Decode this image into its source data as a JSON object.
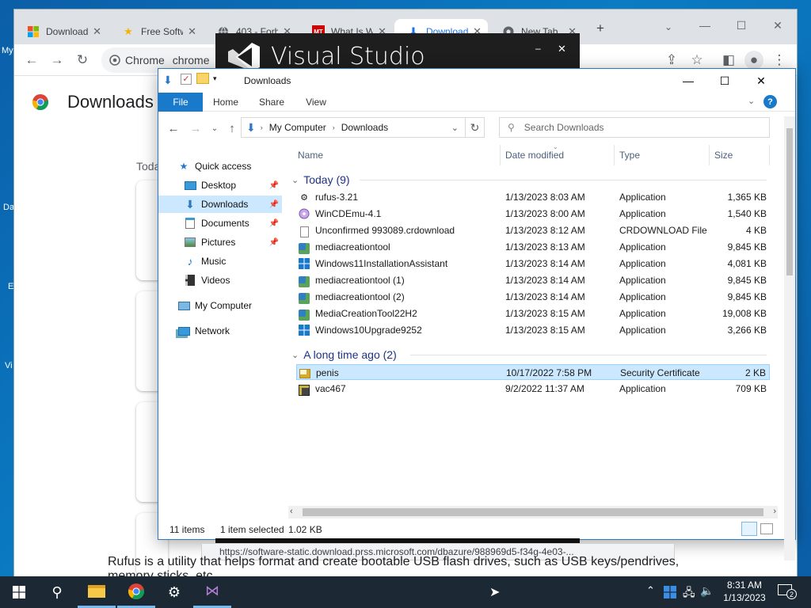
{
  "desktop": {
    "icon_labels": [
      "My",
      "Da",
      "E",
      "Vi"
    ]
  },
  "chrome": {
    "tabs": [
      {
        "label": "Download",
        "icon": "windows-logo-icon",
        "active": false
      },
      {
        "label": "Free Softw",
        "icon": "star-icon",
        "active": false
      },
      {
        "label": "403 - Forb",
        "icon": "globe-icon",
        "active": false
      },
      {
        "label": "What Is W",
        "icon": "mt-logo-icon",
        "active": false
      },
      {
        "label": "Download",
        "icon": "download-arrow-icon",
        "active": true
      },
      {
        "label": "New Tab",
        "icon": "chrome-icon",
        "active": false
      }
    ],
    "omnibox_scheme": "Chrome",
    "omnibox_text": "chrome",
    "page_title": "Downloads",
    "today_label": "Toda"
  },
  "vs_splash": {
    "title": "Visual Studio"
  },
  "explorer": {
    "title": "Downloads",
    "ribbon_tabs": [
      "File",
      "Home",
      "Share",
      "View"
    ],
    "breadcrumb": [
      "My Computer",
      "Downloads"
    ],
    "search_placeholder": "Search Downloads",
    "nav": [
      {
        "label": "Quick access",
        "icon": "star-icon",
        "indent": 0,
        "pinned": false,
        "selected": false
      },
      {
        "label": "Desktop",
        "icon": "desktop-icon",
        "indent": 1,
        "pinned": true,
        "selected": false
      },
      {
        "label": "Downloads",
        "icon": "downloads-icon",
        "indent": 1,
        "pinned": true,
        "selected": true
      },
      {
        "label": "Documents",
        "icon": "documents-icon",
        "indent": 1,
        "pinned": true,
        "selected": false
      },
      {
        "label": "Pictures",
        "icon": "pictures-icon",
        "indent": 1,
        "pinned": true,
        "selected": false
      },
      {
        "label": "Music",
        "icon": "music-icon",
        "indent": 1,
        "pinned": false,
        "selected": false
      },
      {
        "label": "Videos",
        "icon": "videos-icon",
        "indent": 1,
        "pinned": false,
        "selected": false
      },
      {
        "label": "My Computer",
        "icon": "computer-icon",
        "indent": 0,
        "pinned": false,
        "selected": false
      },
      {
        "label": "Network",
        "icon": "network-icon",
        "indent": 0,
        "pinned": false,
        "selected": false
      }
    ],
    "columns": [
      "Name",
      "Date modified",
      "Type",
      "Size"
    ],
    "groups": [
      {
        "label": "Today (9)",
        "files": [
          {
            "name": "rufus-3.21",
            "date": "1/13/2023 8:03 AM",
            "type": "Application",
            "size": "1,365 KB",
            "icon": "rufus-icon"
          },
          {
            "name": "WinCDEmu-4.1",
            "date": "1/13/2023 8:00 AM",
            "type": "Application",
            "size": "1,540 KB",
            "icon": "cd-icon"
          },
          {
            "name": "Unconfirmed 993089.crdownload",
            "date": "1/13/2023 8:12 AM",
            "type": "CRDOWNLOAD File",
            "size": "4 KB",
            "icon": "blank-file-icon"
          },
          {
            "name": "mediacreationtool",
            "date": "1/13/2023 8:13 AM",
            "type": "Application",
            "size": "9,845 KB",
            "icon": "media-tool-icon"
          },
          {
            "name": "Windows11InstallationAssistant",
            "date": "1/13/2023 8:14 AM",
            "type": "Application",
            "size": "4,081 KB",
            "icon": "windows-logo-icon"
          },
          {
            "name": "mediacreationtool (1)",
            "date": "1/13/2023 8:14 AM",
            "type": "Application",
            "size": "9,845 KB",
            "icon": "media-tool-icon"
          },
          {
            "name": "mediacreationtool (2)",
            "date": "1/13/2023 8:14 AM",
            "type": "Application",
            "size": "9,845 KB",
            "icon": "media-tool-icon"
          },
          {
            "name": "MediaCreationTool22H2",
            "date": "1/13/2023 8:15 AM",
            "type": "Application",
            "size": "19,008 KB",
            "icon": "media-tool-icon"
          },
          {
            "name": "Windows10Upgrade9252",
            "date": "1/13/2023 8:15 AM",
            "type": "Application",
            "size": "3,266 KB",
            "icon": "windows-logo-icon"
          }
        ]
      },
      {
        "label": "A long time ago (2)",
        "files": [
          {
            "name": "penis",
            "date": "10/17/2022 7:58 PM",
            "type": "Security Certificate",
            "size": "2 KB",
            "icon": "certificate-icon",
            "selected": true
          },
          {
            "name": "vac467",
            "date": "9/2/2022 11:37 AM",
            "type": "Application",
            "size": "709 KB",
            "icon": "app-icon"
          }
        ]
      }
    ],
    "status": {
      "count": "11 items",
      "selected": "1 item selected",
      "size": "1.02 KB"
    }
  },
  "url_status": "https://software-static.download.prss.microsoft.com/dbazure/988969d5-f34g-4e03-...",
  "overlay_text": "Rufus is a utility that helps format and create bootable USB flash drives, such as USB keys/pendrives, memory sticks, etc.",
  "taskbar": {
    "time": "8:31 AM",
    "date": "1/13/2023",
    "notification_count": "2"
  }
}
